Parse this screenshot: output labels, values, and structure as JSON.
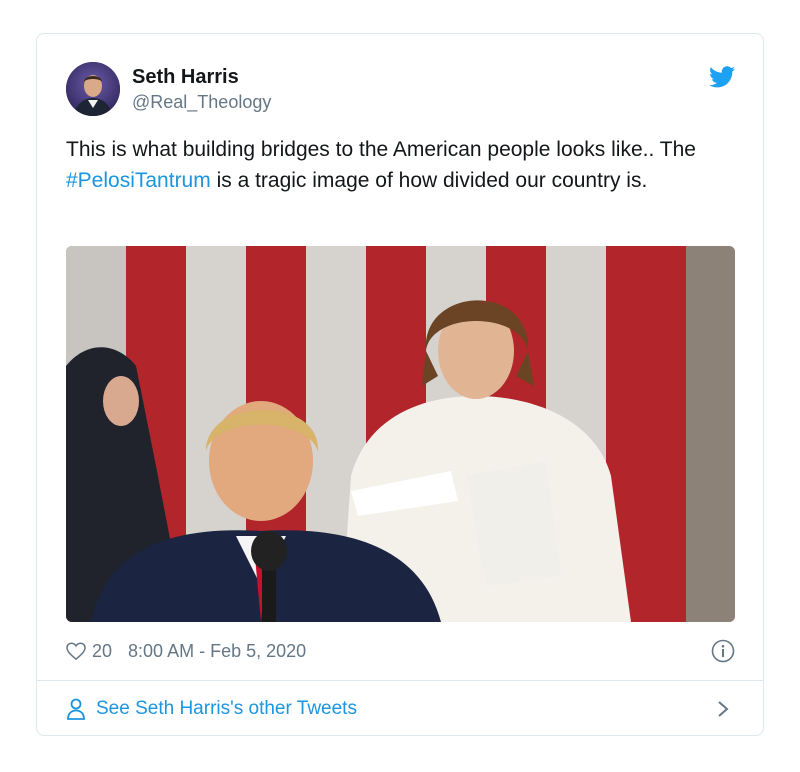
{
  "tweet": {
    "author": {
      "display_name": "Seth Harris",
      "handle": "@Real_Theology",
      "avatar_icon": "user-avatar-photo"
    },
    "text_before": "This is what building bridges to the American people looks like.. The ",
    "hashtag": "#PelosiTantrum",
    "text_after": " is a tragic image of how divided our country is.",
    "media_icon": "photo-image",
    "likes": "20",
    "timestamp": "8:00 AM - Feb 5, 2020"
  },
  "footer": {
    "link_label": "See Seth Harris's other Tweets"
  },
  "colors": {
    "link": "#1b95e0",
    "text": "#14171a",
    "muted": "#657786",
    "border": "#e1e8ed"
  }
}
